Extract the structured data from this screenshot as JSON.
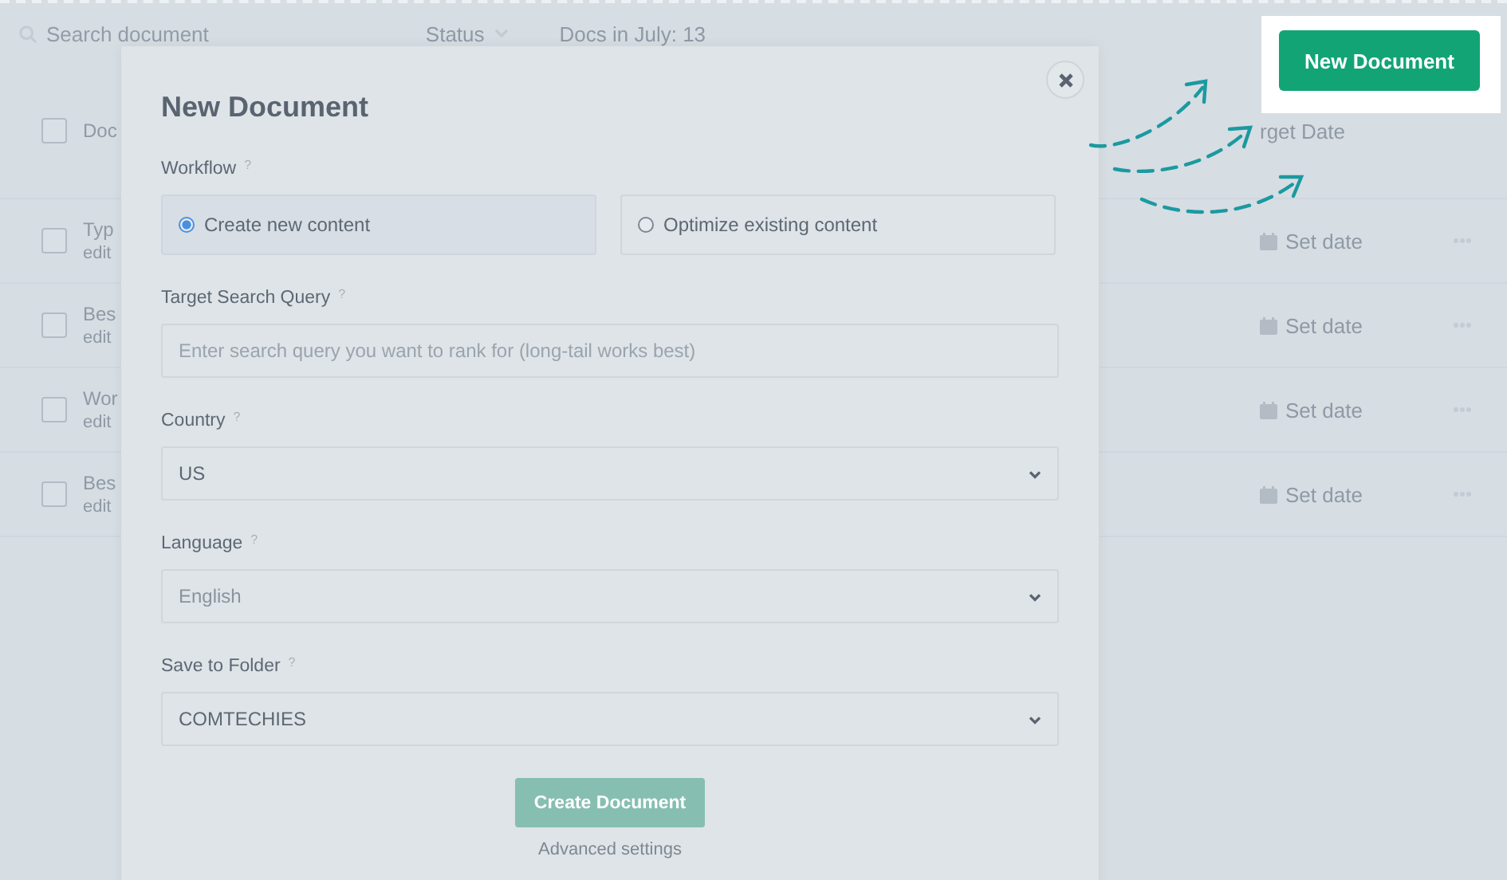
{
  "background": {
    "search": {
      "placeholder": "Search document"
    },
    "status_filter": "Status",
    "docs_count": "Docs in July: 13",
    "table": {
      "columns": [
        "Doc",
        "rget Date"
      ],
      "all_checked": false,
      "rows": [
        {
          "checked": false,
          "title": "Typ",
          "subtitle": "edit",
          "target_date": "Set date"
        },
        {
          "checked": false,
          "title": "Bes",
          "subtitle": "edit",
          "target_date": "Set date"
        },
        {
          "checked": false,
          "title": "Wor",
          "subtitle": "edit",
          "target_date": "Set date"
        },
        {
          "checked": false,
          "title": "Bes",
          "subtitle": "edit",
          "target_date": "Set date"
        }
      ]
    }
  },
  "modal": {
    "title": "New Document",
    "fields": [
      {
        "kind": "radio-group",
        "label": "Workflow",
        "help": "?",
        "options": [
          {
            "label": "Create new content",
            "selected": true
          },
          {
            "label": "Optimize existing content",
            "selected": false
          }
        ]
      },
      {
        "kind": "input",
        "label": "Target Search Query",
        "help": "?",
        "placeholder": "Enter search query you want to rank for (long-tail works best)"
      },
      {
        "kind": "select",
        "label": "Country",
        "help": "?",
        "value": "US"
      },
      {
        "kind": "select",
        "label": "Language",
        "help": "?",
        "value": "English"
      },
      {
        "kind": "select",
        "label": "Save to Folder",
        "help": "?",
        "value": "COMTECHIES"
      }
    ],
    "submit": {
      "label": "Create Document",
      "disabled": true
    },
    "advanced_link": "Advanced settings"
  },
  "highlight_button": {
    "label": "New Document"
  }
}
